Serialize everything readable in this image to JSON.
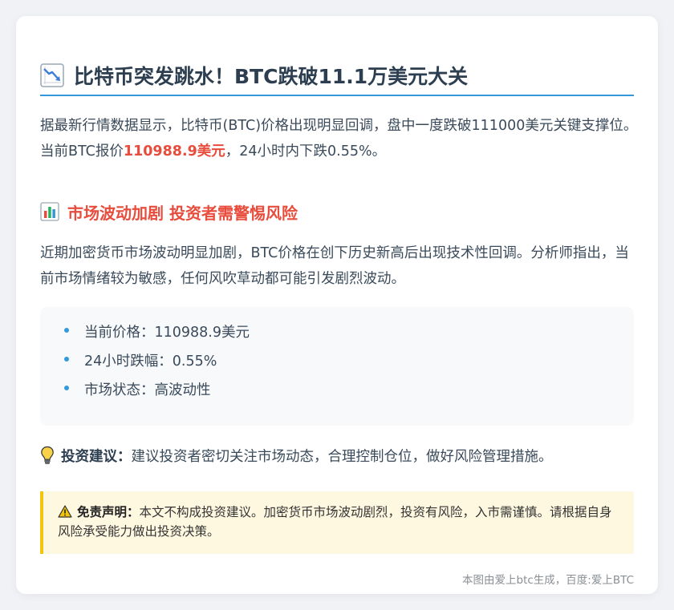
{
  "article": {
    "title_icon": "chart-decreasing-icon",
    "title": "比特币突发跳水！BTC跌破11.1万美元大关",
    "intro": {
      "before": "据最新行情数据显示，比特币(BTC)价格出现明显回调，盘中一度跌破111000美元关键支撑位。当前BTC报价",
      "price_highlight": "110988.9美元",
      "after": "，24小时内下跌0.55%。"
    },
    "section": {
      "icon": "bar-chart-icon",
      "title": "市场波动加剧 投资者需警惕风险",
      "body": "近期加密货币市场波动明显加剧，BTC价格在创下历史新高后出现技术性回调。分析师指出，当前市场情绪较为敏感，任何风吹草动都可能引发剧烈波动。"
    },
    "stats": [
      "当前价格：110988.9美元",
      "24小时跌幅：0.55%",
      "市场状态：高波动性"
    ],
    "advice": {
      "icon": "light-bulb-icon",
      "label": "投资建议：",
      "text": "建议投资者密切关注市场动态，合理控制仓位，做好风险管理措施。"
    },
    "disclaimer": {
      "icon": "warning-icon",
      "label": "免责声明：",
      "text": "本文不构成投资建议。加密货币市场波动剧烈，投资有风险，入市需谨慎。请根据自身风险承受能力做出投资决策。"
    },
    "footer": "本图由爱上btc生成，百度:爱上BTC"
  },
  "colors": {
    "title_text": "#2c3e50",
    "accent_blue": "#3498db",
    "highlight_red": "#e74c3c",
    "disclaimer_bg": "#fff8e1",
    "disclaimer_border": "#f1c40f"
  }
}
